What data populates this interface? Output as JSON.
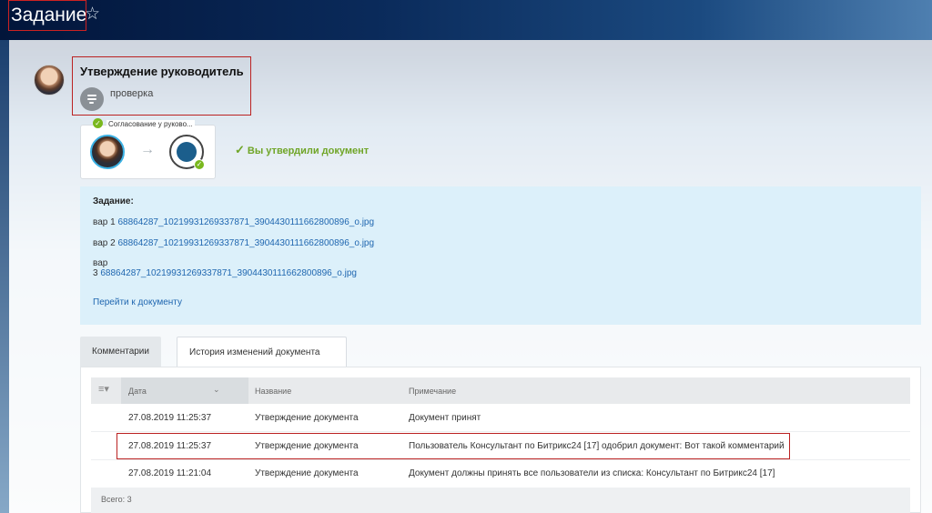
{
  "header": {
    "title": "Задание",
    "favorite_icon": "star-outline-icon"
  },
  "process": {
    "title": "Утверждение руководитель",
    "step_name": "проверка",
    "approval_label": "Согласование у руково...",
    "approved_text": "Вы утвердили документ",
    "approved_icon": "check-icon"
  },
  "task": {
    "label": "Задание:",
    "items": [
      {
        "prefix": "вар 1",
        "file": "68864287_10219931269337871_3904430111662800896_o.jpg"
      },
      {
        "prefix": "вар 2",
        "file": "68864287_10219931269337871_3904430111662800896_o.jpg"
      },
      {
        "prefix_line1": "вар",
        "prefix": "3",
        "file": "68864287_10219931269337871_3904430111662800896_o.jpg"
      }
    ],
    "goto_link": "Перейти к документу"
  },
  "tabs": [
    {
      "label": "Комментарии",
      "active": false
    },
    {
      "label": "История изменений документа",
      "active": true
    }
  ],
  "table": {
    "columns": [
      "Дата",
      "Название",
      "Примечание"
    ],
    "rows": [
      {
        "date": "27.08.2019 11:25:37",
        "name": "Утверждение документа",
        "note": "Документ принят"
      },
      {
        "date": "27.08.2019 11:25:37",
        "name": "Утверждение документа",
        "note": "Пользователь Консультант по Битрикс24 [17] одобрил документ: Вот такой комментарий"
      },
      {
        "date": "27.08.2019 11:21:04",
        "name": "Утверждение документа",
        "note": "Документ должны принять все пользователи из списка: Консультант по Битрикс24 [17]"
      }
    ],
    "footer": "Всего: 3"
  },
  "colors": {
    "accent_green": "#7ab81e",
    "link_blue": "#2067b0",
    "highlight_red": "#bb2222",
    "task_bg": "#dcf0fa"
  }
}
